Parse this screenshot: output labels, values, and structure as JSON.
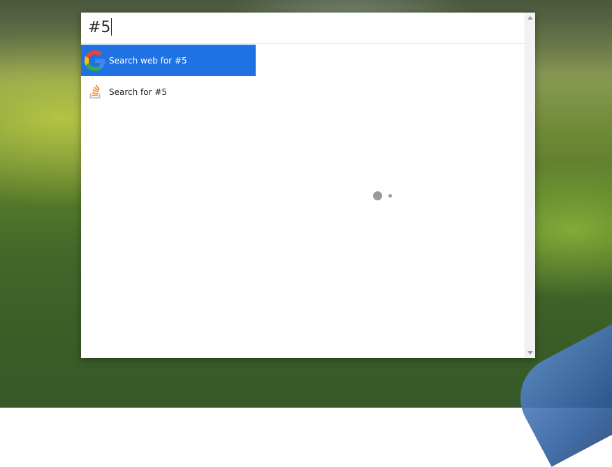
{
  "launcher": {
    "query": "#5"
  },
  "results": [
    {
      "label": "Search web for #5",
      "icon": "google-icon",
      "selected": true
    },
    {
      "label": "Search for #5",
      "icon": "stackoverflow-icon",
      "selected": false
    }
  ],
  "colors": {
    "selection": "#1f72e3",
    "spinner": "#9a9a9a"
  },
  "status": {
    "loading": true
  }
}
